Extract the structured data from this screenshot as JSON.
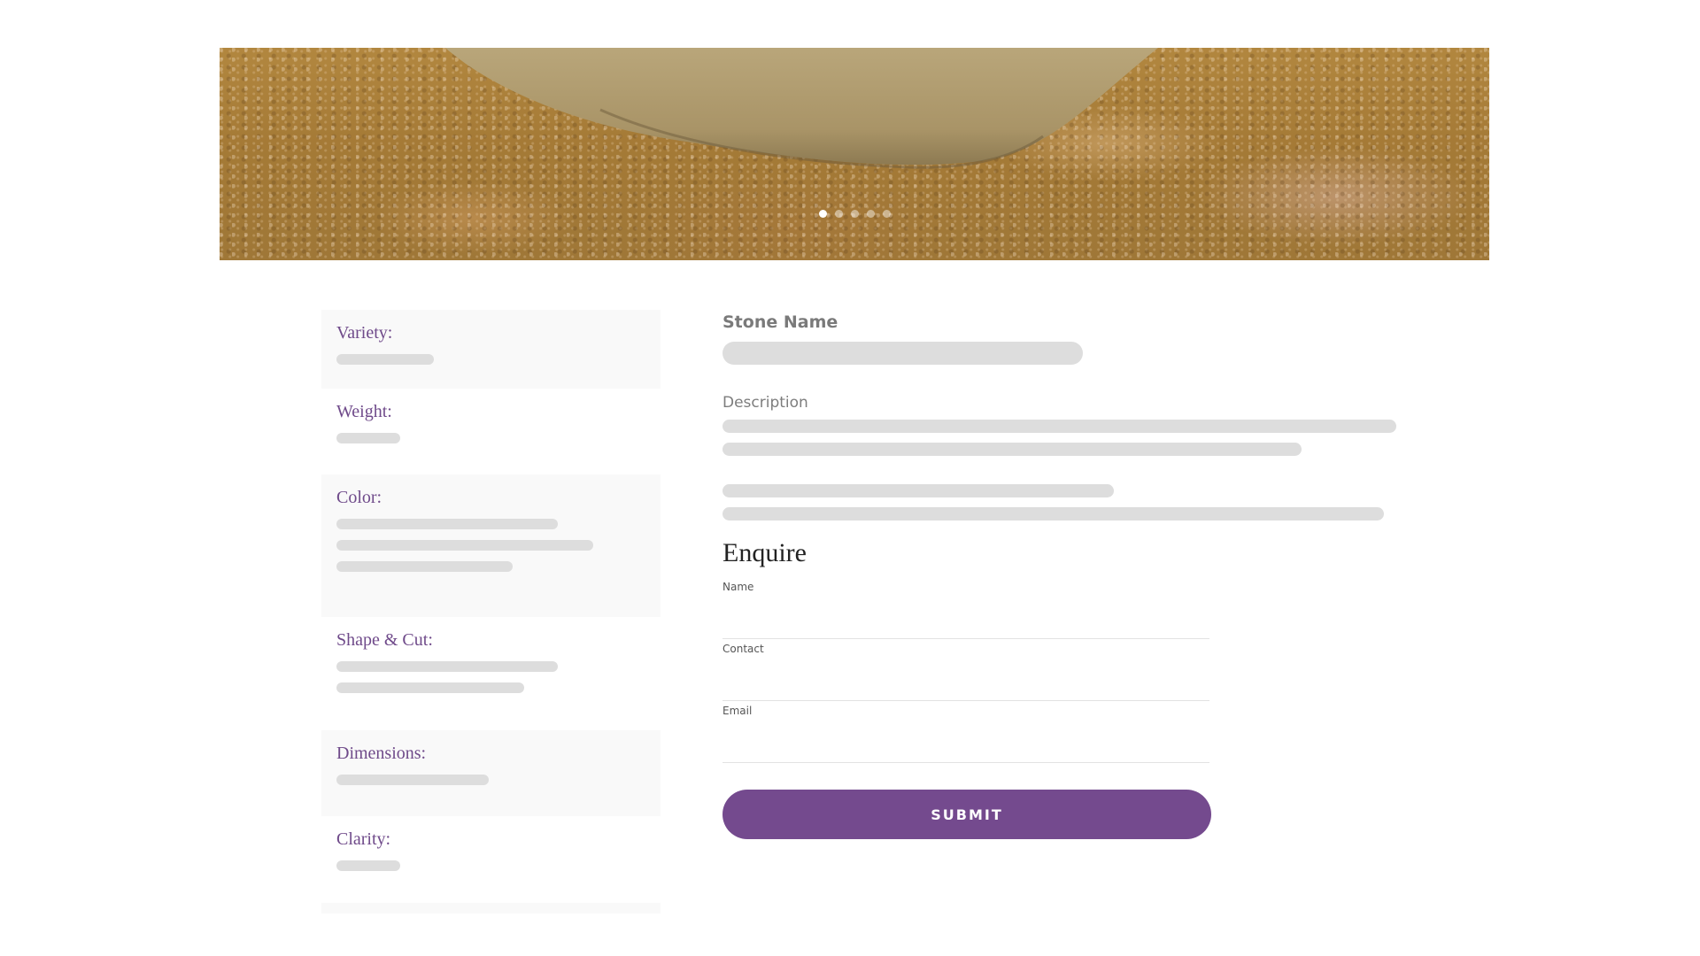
{
  "hero": {
    "slide_count": 5,
    "active_slide": 1
  },
  "specs": {
    "items": [
      {
        "label": "Variety:"
      },
      {
        "label": "Weight:"
      },
      {
        "label": "Color:"
      },
      {
        "label": "Shape & Cut:"
      },
      {
        "label": "Dimensions:"
      },
      {
        "label": "Clarity:"
      }
    ]
  },
  "product": {
    "name_label": "Stone Name",
    "description_label": "Description"
  },
  "enquire": {
    "title": "Enquire",
    "fields": {
      "name_label": "Name",
      "name_value": "",
      "contact_label": "Contact",
      "contact_value": "",
      "email_label": "Email",
      "email_value": ""
    },
    "submit_label": "SUBMIT"
  },
  "colors": {
    "accent": "#744a8e",
    "label": "#6f4a8a",
    "placeholder_bar": "#dddddd",
    "panel_shade": "#f9f9f9"
  }
}
